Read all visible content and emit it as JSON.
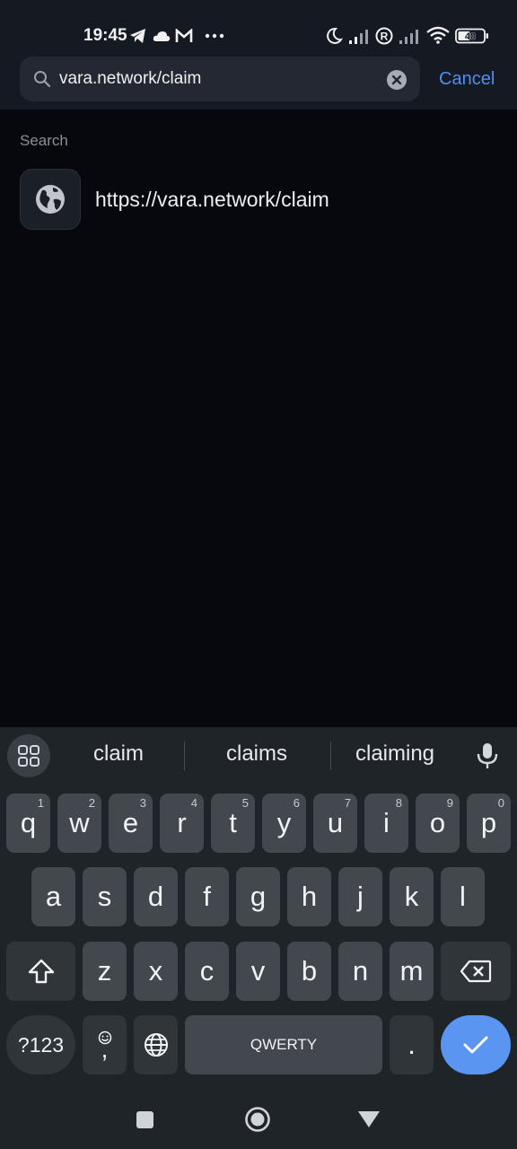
{
  "status_bar": {
    "time": "19:45",
    "left_icons": [
      "telegram-icon",
      "cloud-icon",
      "gmail-icon",
      "more-dots-icon"
    ],
    "right_icons": [
      "moon-icon",
      "signal-icon",
      "registered-icon",
      "signal-icon",
      "wifi-icon",
      "battery-icon"
    ],
    "battery": "48"
  },
  "search": {
    "query": "vara.network/claim",
    "cancel_label": "Cancel"
  },
  "results": {
    "section_label": "Search",
    "items": [
      {
        "icon": "globe-icon",
        "url": "https://vara.network/claim"
      }
    ]
  },
  "keyboard": {
    "suggestions": [
      "claim",
      "claims",
      "claiming"
    ],
    "row1": [
      "q",
      "w",
      "e",
      "r",
      "t",
      "y",
      "u",
      "i",
      "o",
      "p"
    ],
    "row1_hints": [
      "1",
      "2",
      "3",
      "4",
      "5",
      "6",
      "7",
      "8",
      "9",
      "0"
    ],
    "row2": [
      "a",
      "s",
      "d",
      "f",
      "g",
      "h",
      "j",
      "k",
      "l"
    ],
    "row3": [
      "z",
      "x",
      "c",
      "v",
      "b",
      "n",
      "m"
    ],
    "symbols_label": "?123",
    "comma_label": ",",
    "space_label": "QWERTY",
    "period_label": "."
  },
  "colors": {
    "accent": "#4f8ef5",
    "enter_key": "#5a95f2",
    "background": "#06080d"
  }
}
